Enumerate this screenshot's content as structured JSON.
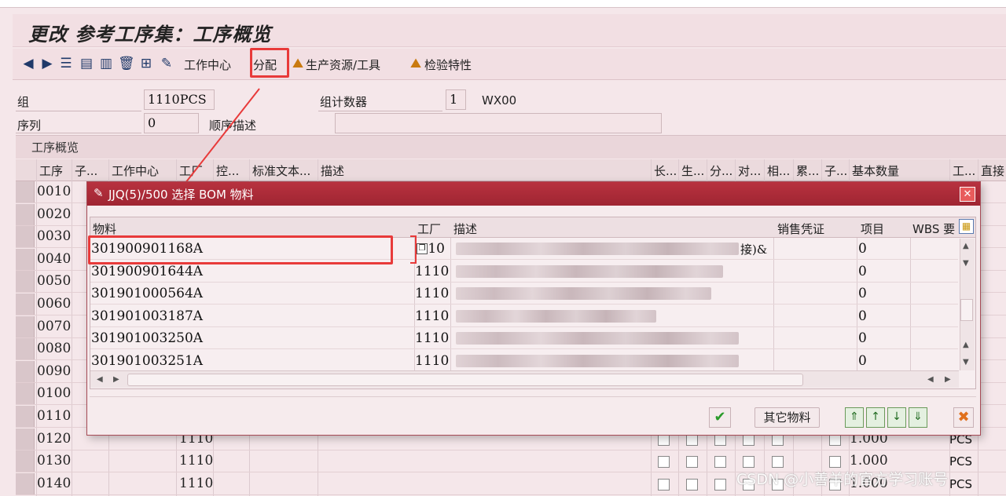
{
  "page": {
    "title": "更改 参考工序集：工序概览"
  },
  "toolbar": {
    "work_center": "工作中心",
    "assign": "分配",
    "prt": "生产资源/工具",
    "inspection": "检验特性"
  },
  "header": {
    "group_label": "组",
    "group_value": "1110PCS",
    "group_counter_label": "组计数器",
    "group_counter_value": "1",
    "group_counter_text": "WX00",
    "sequence_label": "序列",
    "sequence_value": "0",
    "sequence_desc_label": "顺序描述",
    "sequence_desc_value": ""
  },
  "overview": {
    "title": "工序概览",
    "columns": [
      "工序",
      "子...",
      "工作中心",
      "工厂",
      "控...",
      "标准文本...",
      "描述",
      "长...",
      "生...",
      "分...",
      "对...",
      "相...",
      "累...",
      "子...",
      "基本数量",
      "工...",
      "直接"
    ],
    "rows": [
      {
        "op": "0010",
        "plant": "",
        "qty": "",
        "unit": ""
      },
      {
        "op": "0020",
        "plant": "",
        "qty": "",
        "unit": ""
      },
      {
        "op": "0030",
        "plant": "",
        "qty": "",
        "unit": ""
      },
      {
        "op": "0040",
        "plant": "",
        "qty": "",
        "unit": ""
      },
      {
        "op": "0050",
        "plant": "",
        "qty": "",
        "unit": ""
      },
      {
        "op": "0060",
        "plant": "",
        "qty": "",
        "unit": ""
      },
      {
        "op": "0070",
        "plant": "",
        "qty": "",
        "unit": ""
      },
      {
        "op": "0080",
        "plant": "",
        "qty": "",
        "unit": ""
      },
      {
        "op": "0090",
        "plant": "",
        "qty": "",
        "unit": ""
      },
      {
        "op": "0100",
        "plant": "",
        "qty": "",
        "unit": ""
      },
      {
        "op": "0110",
        "plant": "",
        "qty": "",
        "unit": ""
      },
      {
        "op": "0120",
        "plant": "1110",
        "qty": "1.000",
        "unit": "PCS"
      },
      {
        "op": "0130",
        "plant": "1110",
        "qty": "1.000",
        "unit": "PCS"
      },
      {
        "op": "0140",
        "plant": "1110",
        "qty": "1.000",
        "unit": "PCS"
      }
    ]
  },
  "popup": {
    "title": "JJQ(5)/500 选择 BOM 物料",
    "columns": {
      "material": "物料",
      "plant": "工厂",
      "desc": "描述",
      "sales_doc": "销售凭证",
      "item": "项目",
      "wbs": "WBS 要"
    },
    "rows": [
      {
        "material": "301900901168A",
        "plant": "1110",
        "desc_tail": "接)&",
        "item": "0"
      },
      {
        "material": "301900901644A",
        "plant": "1110",
        "desc_tail": "",
        "item": "0"
      },
      {
        "material": "301901000564A",
        "plant": "1110",
        "desc_tail": "",
        "item": "0"
      },
      {
        "material": "301901003187A",
        "plant": "1110",
        "desc_tail": "",
        "item": "0"
      },
      {
        "material": "301901003250A",
        "plant": "1110",
        "desc_tail": "",
        "item": "0"
      },
      {
        "material": "301901003251A",
        "plant": "1110",
        "desc_tail": "",
        "item": "0"
      }
    ],
    "other_material_button": "其它物料"
  },
  "watermark": "CSDN @小善羊的官方学习账号",
  "accent_color": "#e83a3a"
}
